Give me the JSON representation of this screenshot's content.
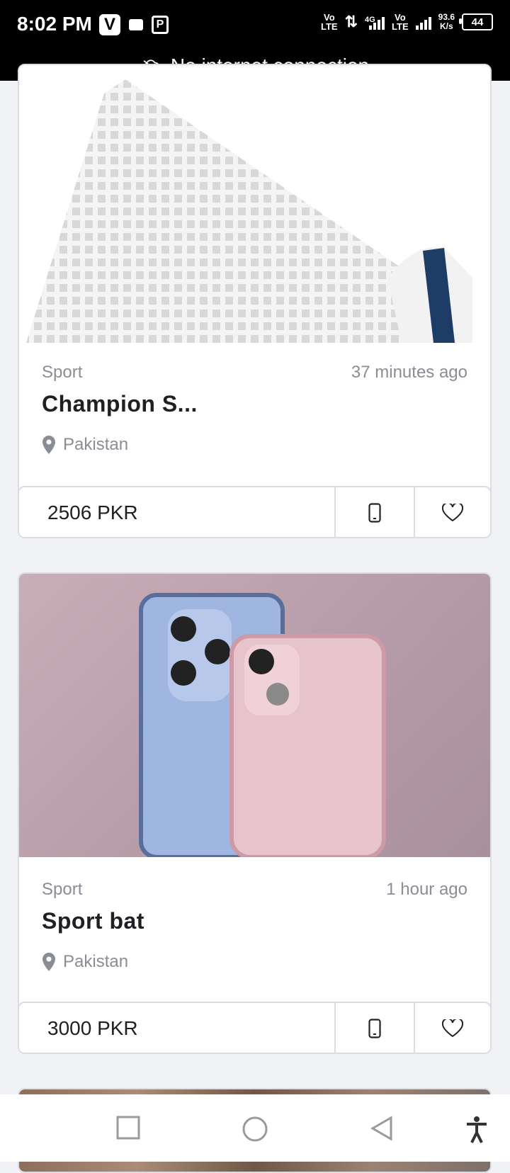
{
  "status_bar": {
    "time": "8:02 PM",
    "v_badge": "V",
    "lte1": [
      "Vo",
      "LTE"
    ],
    "net": "4G",
    "lte2": [
      "Vo",
      "LTE"
    ],
    "speed": [
      "93.6",
      "K/s"
    ],
    "battery": "44"
  },
  "banner": {
    "text": "No internet connection",
    "icon": "cloud-off-icon"
  },
  "listings": [
    {
      "category": "Sport",
      "time": "37 minutes ago",
      "title": "Champion S...",
      "location": "Pakistan",
      "price": "2506 PKR"
    },
    {
      "category": "Sport",
      "time": "1 hour ago",
      "title": "Sport bat",
      "location": "Pakistan",
      "price": "3000 PKR"
    }
  ],
  "icons": {
    "phone": "phone-icon",
    "heart": "heart-icon",
    "pin": "location-pin-icon"
  },
  "nav": [
    "square-button",
    "home-button",
    "back-button",
    "accessibility-button"
  ]
}
